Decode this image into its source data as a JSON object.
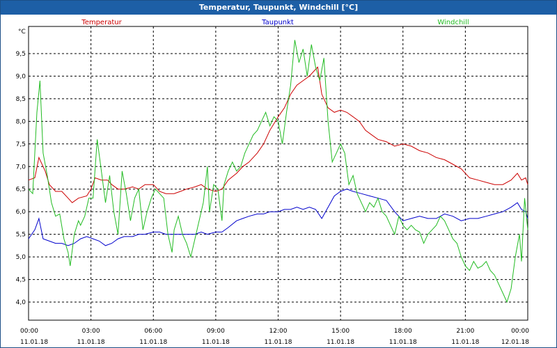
{
  "window": {
    "title": "Temperatur, Taupunkt, Windchill [°C]"
  },
  "chart_data": {
    "type": "line",
    "title": "Temperatur, Taupunkt, Windchill [°C]",
    "ylabel": "°C",
    "xlim": [
      0,
      24
    ],
    "ylim": [
      3.6,
      10.1
    ],
    "grid": true,
    "legend_position": "top",
    "y_ticks": [
      "4,0",
      "4,5",
      "5,0",
      "5,5",
      "6,0",
      "6,5",
      "7,0",
      "7,5",
      "8,0",
      "8,5",
      "9,0",
      "9,5"
    ],
    "y_tick_values": [
      4.0,
      4.5,
      5.0,
      5.5,
      6.0,
      6.5,
      7.0,
      7.5,
      8.0,
      8.5,
      9.0,
      9.5
    ],
    "x_ticks": [
      {
        "time": "00:00",
        "date": "11.01.18"
      },
      {
        "time": "03:00",
        "date": "11.01.18"
      },
      {
        "time": "06:00",
        "date": "11.01.18"
      },
      {
        "time": "09:00",
        "date": "11.01.18"
      },
      {
        "time": "12:00",
        "date": "11.01.18"
      },
      {
        "time": "15:00",
        "date": "11.01.18"
      },
      {
        "time": "18:00",
        "date": "11.01.18"
      },
      {
        "time": "21:00",
        "date": "11.01.18"
      },
      {
        "time": "00:00",
        "date": "12.01.18"
      }
    ],
    "x_tick_values": [
      0,
      3,
      6,
      9,
      12,
      15,
      18,
      21,
      24
    ],
    "series": [
      {
        "name": "Temperatur",
        "color": "#cc0000",
        "points": [
          [
            0,
            6.7
          ],
          [
            0.3,
            6.75
          ],
          [
            0.5,
            7.2
          ],
          [
            0.8,
            6.9
          ],
          [
            1.0,
            6.6
          ],
          [
            1.3,
            6.45
          ],
          [
            1.6,
            6.45
          ],
          [
            1.9,
            6.3
          ],
          [
            2.1,
            6.2
          ],
          [
            2.4,
            6.3
          ],
          [
            2.8,
            6.35
          ],
          [
            3.0,
            6.5
          ],
          [
            3.2,
            6.75
          ],
          [
            3.5,
            6.7
          ],
          [
            3.8,
            6.7
          ],
          [
            4.0,
            6.6
          ],
          [
            4.3,
            6.5
          ],
          [
            4.6,
            6.5
          ],
          [
            5.0,
            6.55
          ],
          [
            5.3,
            6.5
          ],
          [
            5.6,
            6.6
          ],
          [
            6.0,
            6.6
          ],
          [
            6.3,
            6.45
          ],
          [
            6.6,
            6.4
          ],
          [
            7.0,
            6.4
          ],
          [
            7.3,
            6.45
          ],
          [
            7.6,
            6.5
          ],
          [
            8.0,
            6.55
          ],
          [
            8.3,
            6.6
          ],
          [
            8.6,
            6.5
          ],
          [
            9.0,
            6.45
          ],
          [
            9.3,
            6.5
          ],
          [
            9.6,
            6.7
          ],
          [
            10.0,
            6.85
          ],
          [
            10.3,
            7.0
          ],
          [
            10.6,
            7.1
          ],
          [
            11.0,
            7.3
          ],
          [
            11.3,
            7.5
          ],
          [
            11.6,
            7.8
          ],
          [
            12.0,
            8.1
          ],
          [
            12.3,
            8.3
          ],
          [
            12.6,
            8.6
          ],
          [
            12.9,
            8.8
          ],
          [
            13.2,
            8.9
          ],
          [
            13.5,
            9.0
          ],
          [
            13.7,
            9.1
          ],
          [
            13.9,
            9.2
          ],
          [
            14.1,
            8.6
          ],
          [
            14.4,
            8.3
          ],
          [
            14.7,
            8.2
          ],
          [
            15.0,
            8.25
          ],
          [
            15.3,
            8.2
          ],
          [
            15.6,
            8.1
          ],
          [
            15.9,
            8.0
          ],
          [
            16.2,
            7.8
          ],
          [
            16.5,
            7.7
          ],
          [
            16.8,
            7.6
          ],
          [
            17.2,
            7.55
          ],
          [
            17.6,
            7.45
          ],
          [
            18.0,
            7.5
          ],
          [
            18.4,
            7.45
          ],
          [
            18.8,
            7.35
          ],
          [
            19.2,
            7.3
          ],
          [
            19.6,
            7.2
          ],
          [
            20.0,
            7.15
          ],
          [
            20.4,
            7.05
          ],
          [
            20.8,
            6.95
          ],
          [
            21.2,
            6.75
          ],
          [
            21.6,
            6.7
          ],
          [
            22.0,
            6.65
          ],
          [
            22.4,
            6.6
          ],
          [
            22.8,
            6.6
          ],
          [
            23.2,
            6.7
          ],
          [
            23.5,
            6.85
          ],
          [
            23.7,
            6.7
          ],
          [
            23.9,
            6.75
          ],
          [
            24.0,
            6.6
          ]
        ]
      },
      {
        "name": "Taupunkt",
        "color": "#0000cc",
        "points": [
          [
            0,
            5.4
          ],
          [
            0.3,
            5.6
          ],
          [
            0.5,
            5.85
          ],
          [
            0.7,
            5.4
          ],
          [
            1.0,
            5.35
          ],
          [
            1.3,
            5.3
          ],
          [
            1.6,
            5.3
          ],
          [
            1.9,
            5.25
          ],
          [
            2.2,
            5.3
          ],
          [
            2.5,
            5.4
          ],
          [
            2.8,
            5.45
          ],
          [
            3.1,
            5.4
          ],
          [
            3.4,
            5.35
          ],
          [
            3.7,
            5.25
          ],
          [
            4.0,
            5.3
          ],
          [
            4.3,
            5.4
          ],
          [
            4.6,
            5.45
          ],
          [
            5.0,
            5.45
          ],
          [
            5.3,
            5.5
          ],
          [
            5.6,
            5.5
          ],
          [
            6.0,
            5.55
          ],
          [
            6.3,
            5.55
          ],
          [
            6.6,
            5.5
          ],
          [
            7.0,
            5.5
          ],
          [
            7.3,
            5.5
          ],
          [
            7.6,
            5.5
          ],
          [
            8.0,
            5.5
          ],
          [
            8.3,
            5.55
          ],
          [
            8.6,
            5.5
          ],
          [
            9.0,
            5.55
          ],
          [
            9.3,
            5.55
          ],
          [
            9.6,
            5.65
          ],
          [
            10.0,
            5.8
          ],
          [
            10.3,
            5.85
          ],
          [
            10.6,
            5.9
          ],
          [
            11.0,
            5.95
          ],
          [
            11.3,
            5.95
          ],
          [
            11.6,
            6.0
          ],
          [
            12.0,
            6.0
          ],
          [
            12.3,
            6.05
          ],
          [
            12.6,
            6.05
          ],
          [
            12.9,
            6.1
          ],
          [
            13.2,
            6.05
          ],
          [
            13.5,
            6.1
          ],
          [
            13.8,
            6.05
          ],
          [
            14.1,
            5.85
          ],
          [
            14.4,
            6.1
          ],
          [
            14.7,
            6.35
          ],
          [
            15.0,
            6.45
          ],
          [
            15.3,
            6.5
          ],
          [
            15.6,
            6.45
          ],
          [
            16.0,
            6.4
          ],
          [
            16.4,
            6.35
          ],
          [
            16.8,
            6.3
          ],
          [
            17.2,
            6.25
          ],
          [
            17.6,
            6.0
          ],
          [
            18.0,
            5.8
          ],
          [
            18.4,
            5.85
          ],
          [
            18.8,
            5.9
          ],
          [
            19.2,
            5.85
          ],
          [
            19.6,
            5.85
          ],
          [
            20.0,
            5.95
          ],
          [
            20.4,
            5.9
          ],
          [
            20.8,
            5.8
          ],
          [
            21.2,
            5.85
          ],
          [
            21.6,
            5.85
          ],
          [
            22.0,
            5.9
          ],
          [
            22.4,
            5.95
          ],
          [
            22.8,
            6.0
          ],
          [
            23.2,
            6.1
          ],
          [
            23.5,
            6.2
          ],
          [
            23.7,
            6.05
          ],
          [
            23.9,
            6.0
          ],
          [
            24.0,
            5.85
          ]
        ]
      },
      {
        "name": "Windchill",
        "color": "#22bb22",
        "points": [
          [
            0,
            6.5
          ],
          [
            0.2,
            6.4
          ],
          [
            0.4,
            8.2
          ],
          [
            0.55,
            8.9
          ],
          [
            0.7,
            7.3
          ],
          [
            0.9,
            6.8
          ],
          [
            1.1,
            6.2
          ],
          [
            1.3,
            5.9
          ],
          [
            1.5,
            5.95
          ],
          [
            1.7,
            5.4
          ],
          [
            1.9,
            5.1
          ],
          [
            2.0,
            4.8
          ],
          [
            2.2,
            5.5
          ],
          [
            2.4,
            5.8
          ],
          [
            2.5,
            5.7
          ],
          [
            2.7,
            5.9
          ],
          [
            2.9,
            6.3
          ],
          [
            3.1,
            6.3
          ],
          [
            3.3,
            7.6
          ],
          [
            3.5,
            6.9
          ],
          [
            3.7,
            6.2
          ],
          [
            3.9,
            6.8
          ],
          [
            4.1,
            6.0
          ],
          [
            4.3,
            5.5
          ],
          [
            4.5,
            6.9
          ],
          [
            4.7,
            6.4
          ],
          [
            4.9,
            5.8
          ],
          [
            5.1,
            6.3
          ],
          [
            5.3,
            6.5
          ],
          [
            5.5,
            5.6
          ],
          [
            5.7,
            6.0
          ],
          [
            5.9,
            6.3
          ],
          [
            6.1,
            6.5
          ],
          [
            6.3,
            6.4
          ],
          [
            6.5,
            6.3
          ],
          [
            6.7,
            5.5
          ],
          [
            6.9,
            5.1
          ],
          [
            7.0,
            5.6
          ],
          [
            7.2,
            5.9
          ],
          [
            7.4,
            5.5
          ],
          [
            7.6,
            5.3
          ],
          [
            7.8,
            5.0
          ],
          [
            8.0,
            5.4
          ],
          [
            8.2,
            5.8
          ],
          [
            8.4,
            6.2
          ],
          [
            8.6,
            7.0
          ],
          [
            8.7,
            6.0
          ],
          [
            8.9,
            6.6
          ],
          [
            9.1,
            6.5
          ],
          [
            9.3,
            5.8
          ],
          [
            9.4,
            6.6
          ],
          [
            9.6,
            6.9
          ],
          [
            9.8,
            7.1
          ],
          [
            10.0,
            6.9
          ],
          [
            10.2,
            7.0
          ],
          [
            10.4,
            7.3
          ],
          [
            10.6,
            7.5
          ],
          [
            10.8,
            7.7
          ],
          [
            11.0,
            7.8
          ],
          [
            11.2,
            8.0
          ],
          [
            11.4,
            8.2
          ],
          [
            11.6,
            7.9
          ],
          [
            11.8,
            8.1
          ],
          [
            12.0,
            8.0
          ],
          [
            12.2,
            7.5
          ],
          [
            12.4,
            8.2
          ],
          [
            12.6,
            8.8
          ],
          [
            12.8,
            9.8
          ],
          [
            13.0,
            9.3
          ],
          [
            13.2,
            9.6
          ],
          [
            13.4,
            9.0
          ],
          [
            13.6,
            9.7
          ],
          [
            13.8,
            9.2
          ],
          [
            14.0,
            8.9
          ],
          [
            14.2,
            9.4
          ],
          [
            14.4,
            8.0
          ],
          [
            14.6,
            7.1
          ],
          [
            14.8,
            7.3
          ],
          [
            15.0,
            7.5
          ],
          [
            15.2,
            7.3
          ],
          [
            15.4,
            6.6
          ],
          [
            15.6,
            6.8
          ],
          [
            15.8,
            6.4
          ],
          [
            16.0,
            6.2
          ],
          [
            16.2,
            6.0
          ],
          [
            16.4,
            6.2
          ],
          [
            16.6,
            6.1
          ],
          [
            16.8,
            6.3
          ],
          [
            17.0,
            6.0
          ],
          [
            17.2,
            5.9
          ],
          [
            17.4,
            5.7
          ],
          [
            17.6,
            5.5
          ],
          [
            17.8,
            5.9
          ],
          [
            18.0,
            5.7
          ],
          [
            18.2,
            5.6
          ],
          [
            18.4,
            5.7
          ],
          [
            18.6,
            5.6
          ],
          [
            18.8,
            5.55
          ],
          [
            19.0,
            5.3
          ],
          [
            19.2,
            5.5
          ],
          [
            19.4,
            5.6
          ],
          [
            19.6,
            5.7
          ],
          [
            19.8,
            5.9
          ],
          [
            20.0,
            5.8
          ],
          [
            20.2,
            5.6
          ],
          [
            20.4,
            5.4
          ],
          [
            20.6,
            5.3
          ],
          [
            20.8,
            5.0
          ],
          [
            21.0,
            4.8
          ],
          [
            21.2,
            4.7
          ],
          [
            21.4,
            4.9
          ],
          [
            21.6,
            4.75
          ],
          [
            21.8,
            4.8
          ],
          [
            22.0,
            4.9
          ],
          [
            22.2,
            4.7
          ],
          [
            22.4,
            4.6
          ],
          [
            22.6,
            4.4
          ],
          [
            22.8,
            4.2
          ],
          [
            23.0,
            4.0
          ],
          [
            23.2,
            4.3
          ],
          [
            23.4,
            5.0
          ],
          [
            23.6,
            5.5
          ],
          [
            23.7,
            4.9
          ],
          [
            23.85,
            6.3
          ],
          [
            24.0,
            5.6
          ]
        ]
      }
    ]
  }
}
